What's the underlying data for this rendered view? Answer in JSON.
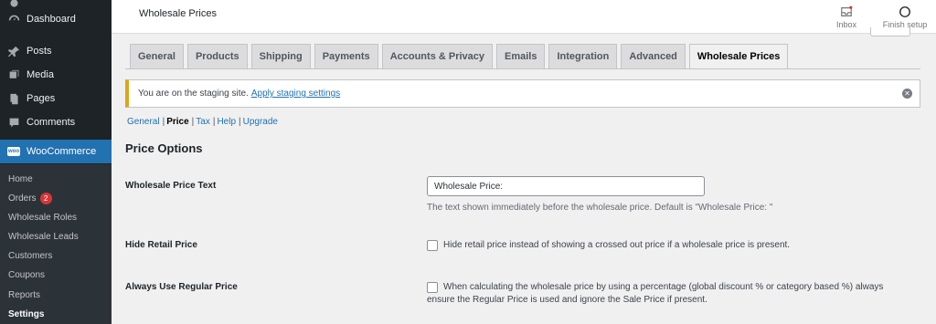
{
  "sidebar": {
    "dashboard": "Dashboard",
    "posts": "Posts",
    "media": "Media",
    "pages": "Pages",
    "comments": "Comments",
    "woocommerce": "WooCommerce",
    "sub": {
      "home": "Home",
      "orders": "Orders",
      "orders_count": "2",
      "wholesale_roles": "Wholesale Roles",
      "wholesale_leads": "Wholesale Leads",
      "customers": "Customers",
      "coupons": "Coupons",
      "reports": "Reports",
      "settings": "Settings"
    }
  },
  "header": {
    "title": "Wholesale Prices",
    "inbox": "Inbox",
    "finish_setup": "Finish setup"
  },
  "tabs": [
    "General",
    "Products",
    "Shipping",
    "Payments",
    "Accounts & Privacy",
    "Emails",
    "Integration",
    "Advanced",
    "Wholesale Prices"
  ],
  "notice": {
    "text": "You are on the staging site.",
    "link": "Apply staging settings"
  },
  "subnav": {
    "general": "General",
    "price": "Price",
    "tax": "Tax",
    "help": "Help",
    "upgrade": "Upgrade"
  },
  "section_title": "Price Options",
  "fields": {
    "wholesale_text_label": "Wholesale Price Text",
    "wholesale_text_value": "Wholesale Price:",
    "wholesale_text_desc": "The text shown immediately before the wholesale price. Default is \"Wholesale Price: \"",
    "hide_retail_label": "Hide Retail Price",
    "hide_retail_desc": "Hide retail price instead of showing a crossed out price if a wholesale price is present.",
    "always_regular_label": "Always Use Regular Price",
    "always_regular_desc_1": "When calculating the wholesale price by using a percentage (global discount % or category based %) always",
    "always_regular_desc_2": "ensure the Regular Price is used and ignore the Sale Price if present."
  },
  "colors": {
    "sidebar_bg": "#1d2327",
    "accent": "#2271b1",
    "notice_border": "#dba617"
  }
}
